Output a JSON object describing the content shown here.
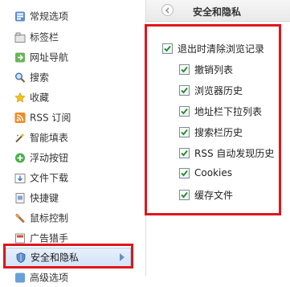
{
  "sidebar": {
    "items": [
      {
        "label": "常规选项",
        "icon": "settings-icon",
        "selected": false
      },
      {
        "label": "标签栏",
        "icon": "tab-icon",
        "selected": false
      },
      {
        "label": "网址导航",
        "icon": "navigation-icon",
        "selected": false
      },
      {
        "label": "搜索",
        "icon": "search-icon",
        "selected": false
      },
      {
        "label": "收藏",
        "icon": "star-icon",
        "selected": false
      },
      {
        "label": "RSS 订阅",
        "icon": "rss-icon",
        "selected": false
      },
      {
        "label": "智能填表",
        "icon": "wand-icon",
        "selected": false
      },
      {
        "label": "浮动按钮",
        "icon": "plus-circle-icon",
        "selected": false
      },
      {
        "label": "文件下载",
        "icon": "download-icon",
        "selected": false
      },
      {
        "label": "快捷键",
        "icon": "keyboard-icon",
        "selected": false
      },
      {
        "label": "鼠标控制",
        "icon": "mouse-icon",
        "selected": false
      },
      {
        "label": "广告猎手",
        "icon": "ad-icon",
        "selected": false
      },
      {
        "label": "安全和隐私",
        "icon": "shield-icon",
        "selected": true
      },
      {
        "label": "高级选项",
        "icon": "advanced-icon",
        "selected": false
      }
    ]
  },
  "panel": {
    "title": "安全和隐私",
    "options": [
      {
        "label": "退出时清除浏览记录",
        "checked": true,
        "level": 0
      },
      {
        "label": "撤销列表",
        "checked": true,
        "level": 1
      },
      {
        "label": "浏览器历史",
        "checked": true,
        "level": 1
      },
      {
        "label": "地址栏下拉列表",
        "checked": true,
        "level": 1
      },
      {
        "label": "搜索栏历史",
        "checked": true,
        "level": 1
      },
      {
        "label": "RSS 自动发现历史",
        "checked": true,
        "level": 1
      },
      {
        "label": "Cookies",
        "checked": true,
        "level": 1
      },
      {
        "label": "缓存文件",
        "checked": true,
        "level": 1
      }
    ]
  },
  "colors": {
    "highlight_border": "#e0161b",
    "selected_bg": "#dce8f8",
    "check_color": "#1f8a1f"
  }
}
